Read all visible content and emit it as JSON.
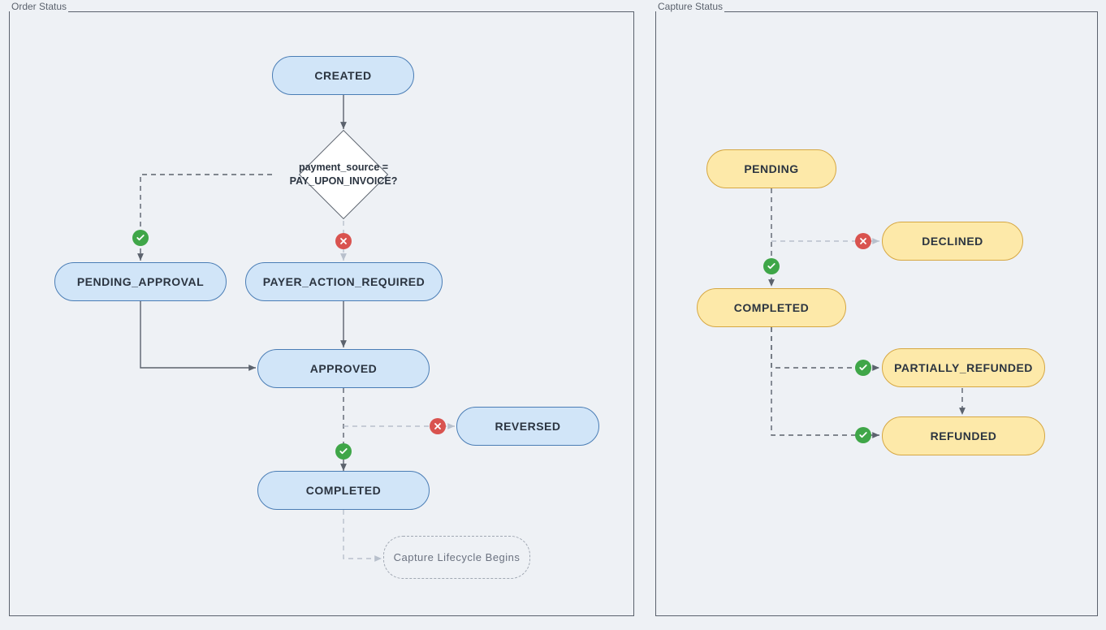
{
  "panels": {
    "order": {
      "title": "Order Status"
    },
    "capture": {
      "title": "Capture Status"
    }
  },
  "order_nodes": {
    "created": "CREATED",
    "decision": "payment_source = PAY_UPON_INVOICE?",
    "pending_approval": "PENDING_APPROVAL",
    "payer_action_required": "PAYER_ACTION_REQUIRED",
    "approved": "APPROVED",
    "reversed": "REVERSED",
    "completed": "COMPLETED",
    "capture_begins": "Capture Lifecycle Begins"
  },
  "capture_nodes": {
    "pending": "PENDING",
    "declined": "DECLINED",
    "completed": "COMPLETED",
    "partially_refunded": "PARTIALLY_REFUNDED",
    "refunded": "REFUNDED"
  },
  "colors": {
    "blue_fill": "#d1e5f8",
    "blue_stroke": "#4a7db5",
    "yellow_fill": "#fde9a9",
    "yellow_stroke": "#d6a742",
    "ok_badge": "#3fa648",
    "no_badge": "#d9534f",
    "panel_border": "#5b626d",
    "bg": "#eef1f5"
  }
}
